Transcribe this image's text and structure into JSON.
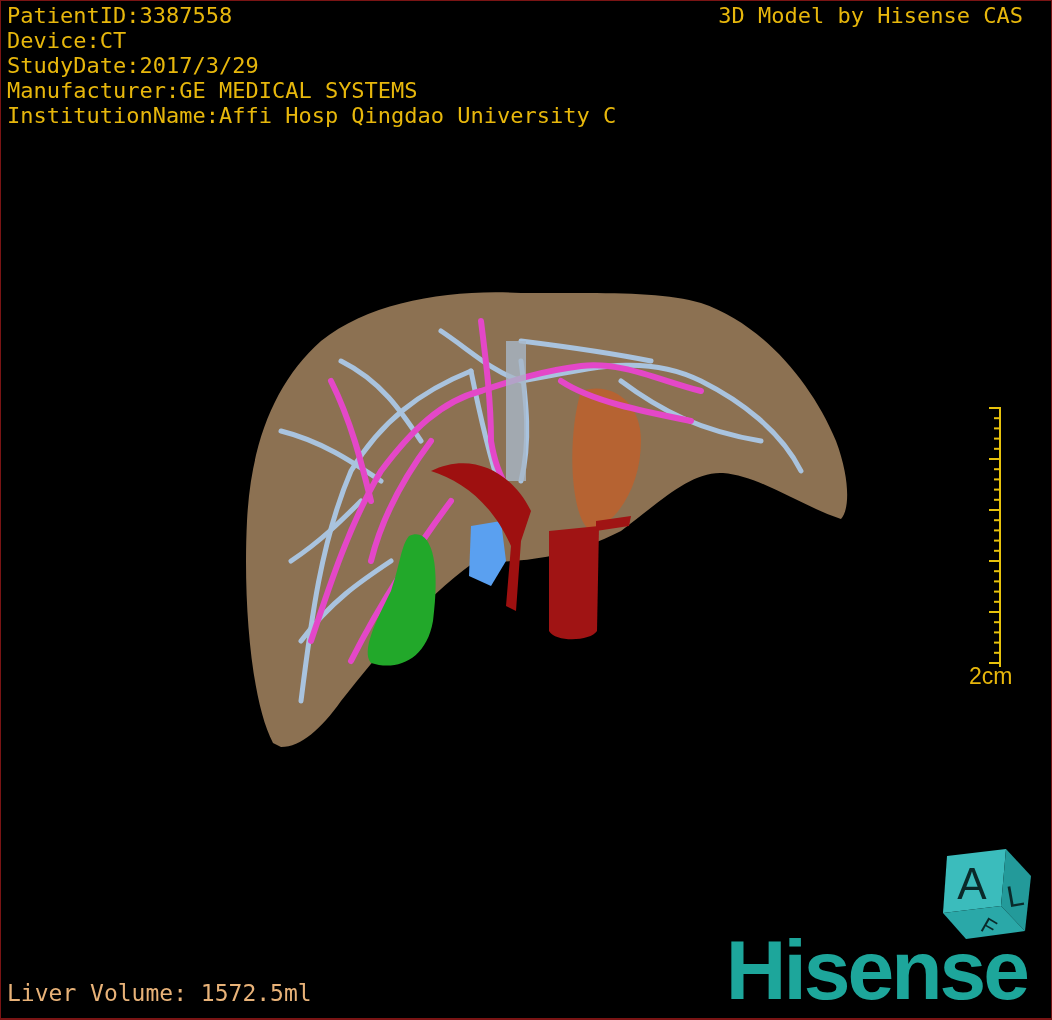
{
  "info_lines": [
    "PatientID:3387558",
    "Device:CT",
    "StudyDate:2017/3/29",
    "Manufacturer:GE MEDICAL SYSTEMS",
    "InstitutionName:Affi Hosp Qingdao University C"
  ],
  "credit": "3D Model by Hisense CAS",
  "scale_bar": {
    "label": "2cm"
  },
  "orientation_cube": {
    "labels": [
      "A",
      "L",
      "F"
    ]
  },
  "logo": "Hisense",
  "liver_volume": "Liver Volume: 1572.5ml"
}
